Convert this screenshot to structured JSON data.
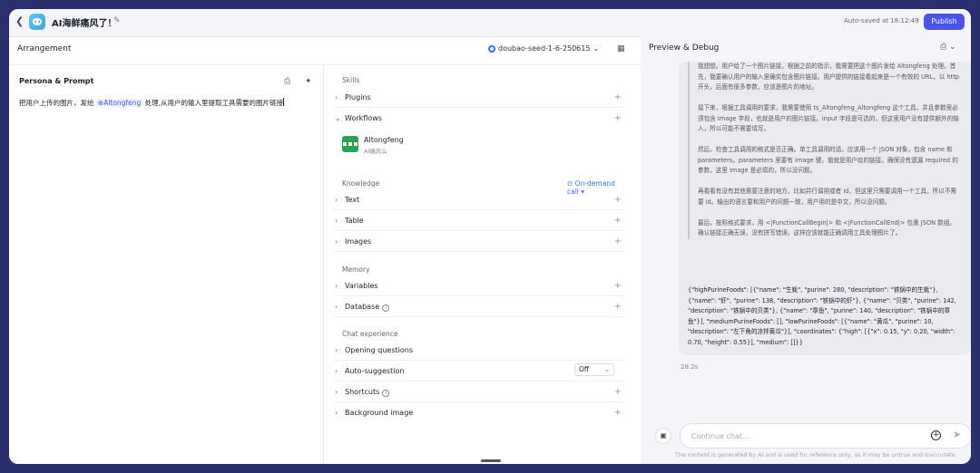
{
  "header": {
    "title": "AI海鲜痛风了！",
    "autosave": "Auto-saved at 18:12:49",
    "publish_label": "Publish"
  },
  "arrangement": {
    "title": "Arrangement",
    "model": "doubao-seed-1-6-250615"
  },
  "persona": {
    "title": "Persona & Prompt",
    "text_before": "把用户上传的图片，发给",
    "tag": "Altongfeng",
    "text_after": "处理,从用户的输入里提取工具需要的图片链接"
  },
  "skills": {
    "label": "Skills",
    "plugins": "Plugins",
    "workflows": "Workflows",
    "workflow_item": {
      "name": "Altongfeng",
      "desc": "AI痛风么"
    }
  },
  "knowledge": {
    "label": "Knowledge",
    "on_demand": "On-demand call",
    "text": "Text",
    "table": "Table",
    "images": "Images"
  },
  "memory": {
    "label": "Memory",
    "variables": "Variables",
    "database": "Database"
  },
  "chat_experience": {
    "label": "Chat experience",
    "opening": "Opening questions",
    "auto_suggestion": "Auto-suggestion",
    "auto_suggestion_value": "Off",
    "shortcuts": "Shortcuts",
    "background": "Background image"
  },
  "preview": {
    "title": "Preview & Debug",
    "think": [
      "我想想。用户给了一个图片链接，根据之前的指示，我需要把这个图片发给 Altongfeng 处理。首先，我要确认用户的输入里确实包含图片链接。用户提供的链接看起来是一个有效的 URL，以 http 开头，后面有很多参数，应该是图片的地址。",
      "接下来，根据工具调用的要求，我需要使用 ts_Altongfeng_Altongfeng 这个工具，并且参数里必须包含 image 字段，也就是用户的图片链接。input 字段是可选的，但这里用户没有提供额外的输入，所以可能不需要填写。",
      "然后，检查工具调用的格式是否正确。单工具调用的话，应该用一个 JSON 对象，包含 name 和 parameters。parameters 里要有 image 键，值就是用户给的链接。确保没有遗漏 required 的参数，这里 image 是必填的，所以没问题。",
      "再看看有没有其他需要注意的地方，比如并行调用或者 id，但这里只需要调用一个工具，所以不需要 id。输出的语言要和用户的问题一致，用户用的是中文，所以没问题。",
      "最后，按照格式要求，用 <|FunctionCallBegin|> 和 <|FunctionCallEnd|> 包裹 JSON 数组。确认链接正确无误，没有拼写错误。这样应该就能正确调用工具处理图片了。"
    ],
    "json_output": "{\"highPurineFoods\": [{\"name\": \"生蚝\", \"purine\": 280, \"description\": \"铁锅中的生蚝\"}, {\"name\": \"虾\", \"purine\": 138, \"description\": \"铁锅中的虾\"}, {\"name\": \"贝类\", \"purine\": 142, \"description\": \"铁锅中的贝类\"}, {\"name\": \"章鱼\", \"purine\": 140, \"description\": \"铁锅中的章鱼\"}], \"mediumPurineFoods\": [], \"lowPurineFoods\": [{\"name\": \"黄瓜\", \"purine\": 10, \"description\": \"左下角的凉拌黄瓜\"}], \"coordinates\": {\"high\": [{\"x\": 0.15, \"y\": 0.20, \"width\": 0.70, \"height\": 0.55}], \"medium\": []}}",
    "timing": "28.2s",
    "input_placeholder": "Continue chat...",
    "disclaimer": "The content is generated by AI and is used for reference only, as it may be untrue and inaccurate."
  }
}
